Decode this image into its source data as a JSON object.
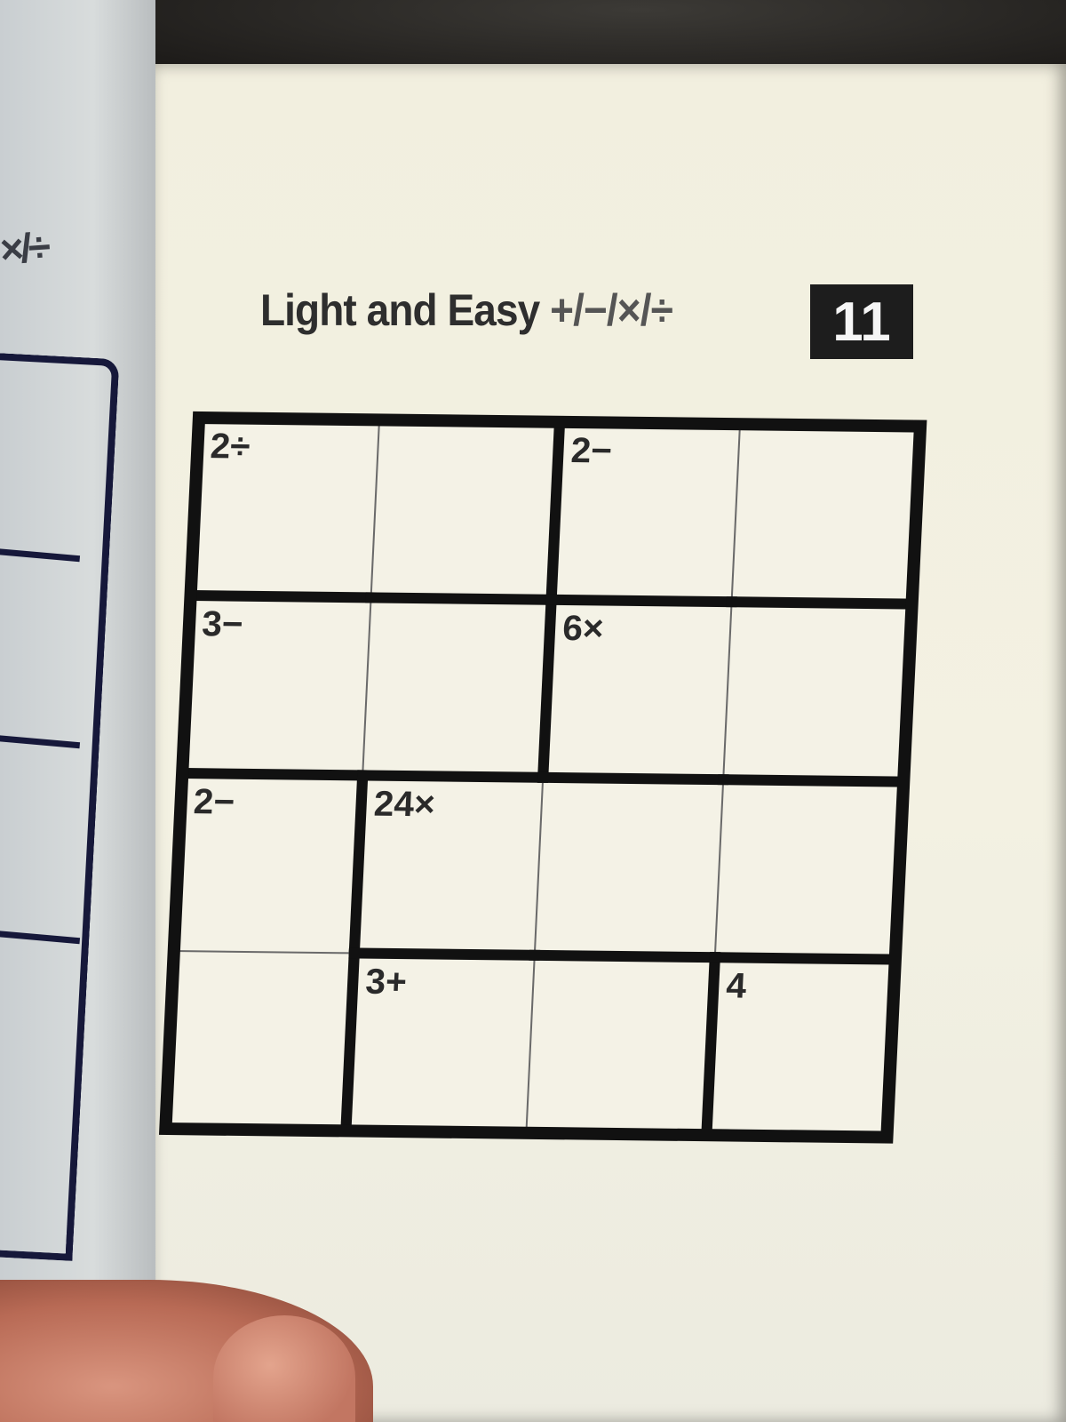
{
  "header": {
    "title": "Light and Easy",
    "operations": "+/−/×/÷",
    "puzzle_number": "11"
  },
  "puzzle": {
    "size": 4,
    "cages": [
      {
        "clue": "2÷",
        "cells": [
          [
            0,
            0
          ],
          [
            0,
            1
          ]
        ]
      },
      {
        "clue": "2−",
        "cells": [
          [
            0,
            2
          ],
          [
            0,
            3
          ]
        ]
      },
      {
        "clue": "3−",
        "cells": [
          [
            1,
            0
          ],
          [
            1,
            1
          ]
        ]
      },
      {
        "clue": "6×",
        "cells": [
          [
            1,
            2
          ],
          [
            1,
            3
          ]
        ]
      },
      {
        "clue": "2−",
        "cells": [
          [
            2,
            0
          ],
          [
            3,
            0
          ]
        ]
      },
      {
        "clue": "24×",
        "cells": [
          [
            2,
            1
          ],
          [
            2,
            2
          ],
          [
            2,
            3
          ]
        ]
      },
      {
        "clue": "3+",
        "cells": [
          [
            3,
            1
          ],
          [
            3,
            2
          ]
        ]
      },
      {
        "clue": "4",
        "cells": [
          [
            3,
            3
          ]
        ]
      }
    ]
  },
  "left_page": {
    "fragment": "×/÷"
  }
}
